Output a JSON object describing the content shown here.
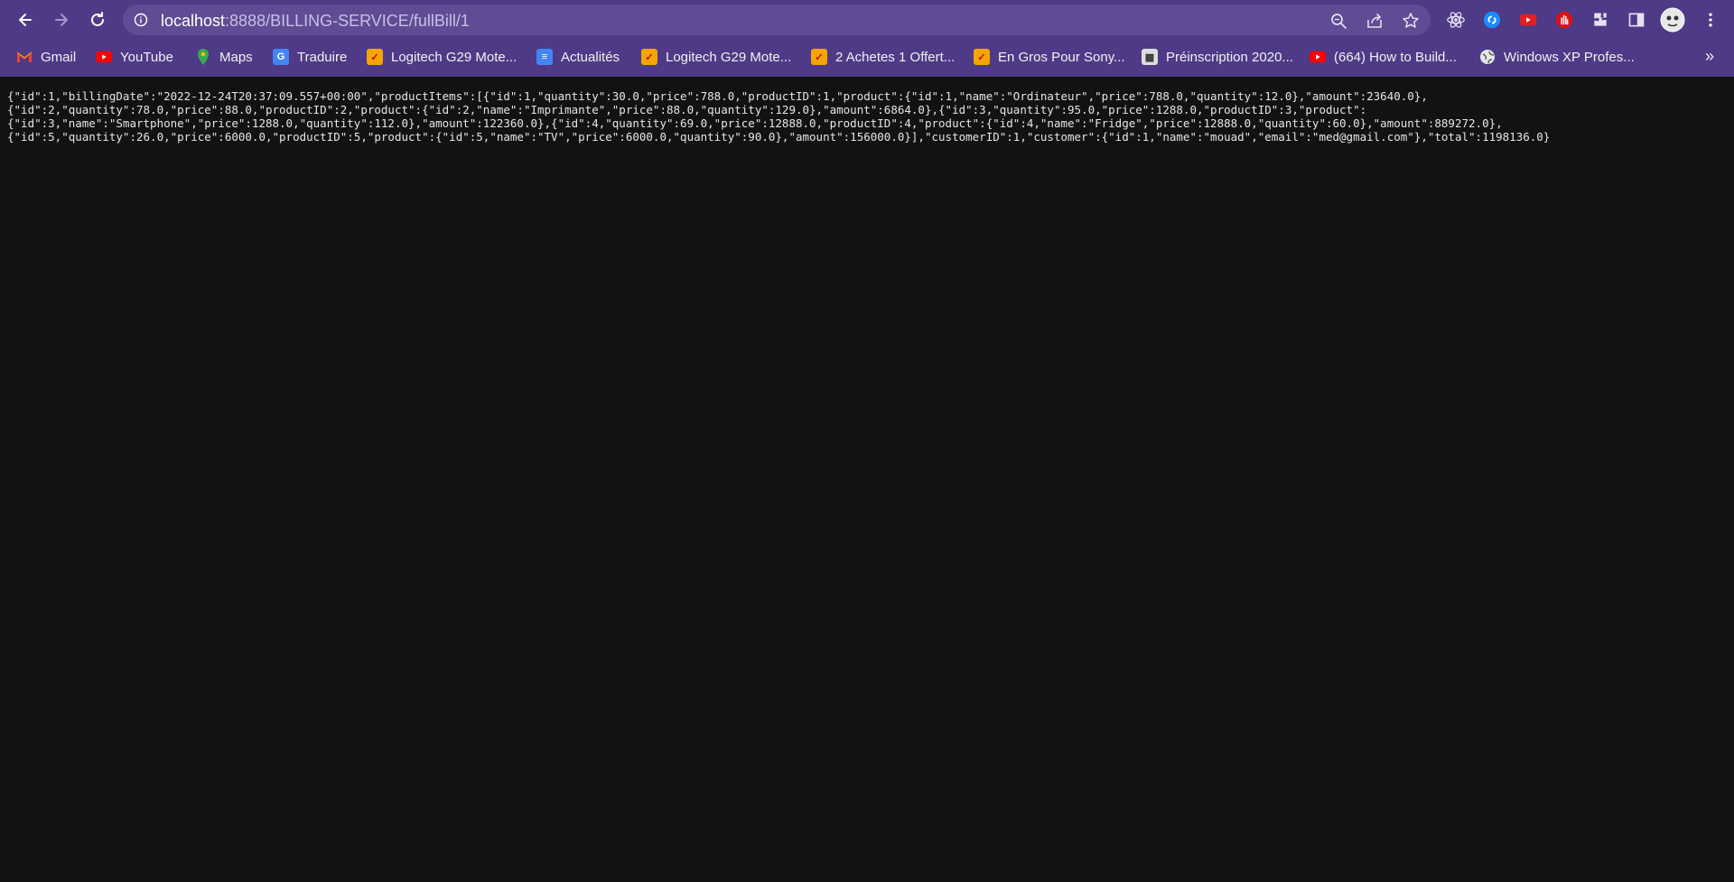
{
  "browser": {
    "url_host": "localhost",
    "url_path": ":8888/BILLING-SERVICE/fullBill/1",
    "accent_color": "#4e3a86"
  },
  "bookmarks": [
    {
      "label": "Gmail",
      "icon": "gmail-icon"
    },
    {
      "label": "YouTube",
      "icon": "youtube-icon"
    },
    {
      "label": "Maps",
      "icon": "maps-icon"
    },
    {
      "label": "Traduire",
      "icon": "translate-icon"
    },
    {
      "label": "Logitech G29 Mote...",
      "icon": "store-icon"
    },
    {
      "label": "Actualités",
      "icon": "news-icon"
    },
    {
      "label": "Logitech G29 Mote...",
      "icon": "store-icon"
    },
    {
      "label": "2 Achetes 1 Offert...",
      "icon": "store-icon"
    },
    {
      "label": "En Gros Pour Sony...",
      "icon": "store-icon"
    },
    {
      "label": "Préinscription 2020...",
      "icon": "university-icon"
    },
    {
      "label": "(664) How to Build...",
      "icon": "youtube-icon"
    },
    {
      "label": "Windows XP Profes...",
      "icon": "globe-icon"
    }
  ],
  "content": {
    "lines": [
      "{\"id\":1,\"billingDate\":\"2022-12-24T20:37:09.557+00:00\",\"productItems\":[{\"id\":1,\"quantity\":30.0,\"price\":788.0,\"productID\":1,\"product\":{\"id\":1,\"name\":\"Ordinateur\",\"price\":788.0,\"quantity\":12.0},\"amount\":23640.0},",
      "{\"id\":2,\"quantity\":78.0,\"price\":88.0,\"productID\":2,\"product\":{\"id\":2,\"name\":\"Imprimante\",\"price\":88.0,\"quantity\":129.0},\"amount\":6864.0},{\"id\":3,\"quantity\":95.0,\"price\":1288.0,\"productID\":3,\"product\":",
      "{\"id\":3,\"name\":\"Smartphone\",\"price\":1288.0,\"quantity\":112.0},\"amount\":122360.0},{\"id\":4,\"quantity\":69.0,\"price\":12888.0,\"productID\":4,\"product\":{\"id\":4,\"name\":\"Fridge\",\"price\":12888.0,\"quantity\":60.0},\"amount\":889272.0},",
      "{\"id\":5,\"quantity\":26.0,\"price\":6000.0,\"productID\":5,\"product\":{\"id\":5,\"name\":\"TV\",\"price\":6000.0,\"quantity\":90.0},\"amount\":156000.0}],\"customerID\":1,\"customer\":{\"id\":1,\"name\":\"mouad\",\"email\":\"med@gmail.com\"},\"total\":1198136.0}"
    ]
  }
}
